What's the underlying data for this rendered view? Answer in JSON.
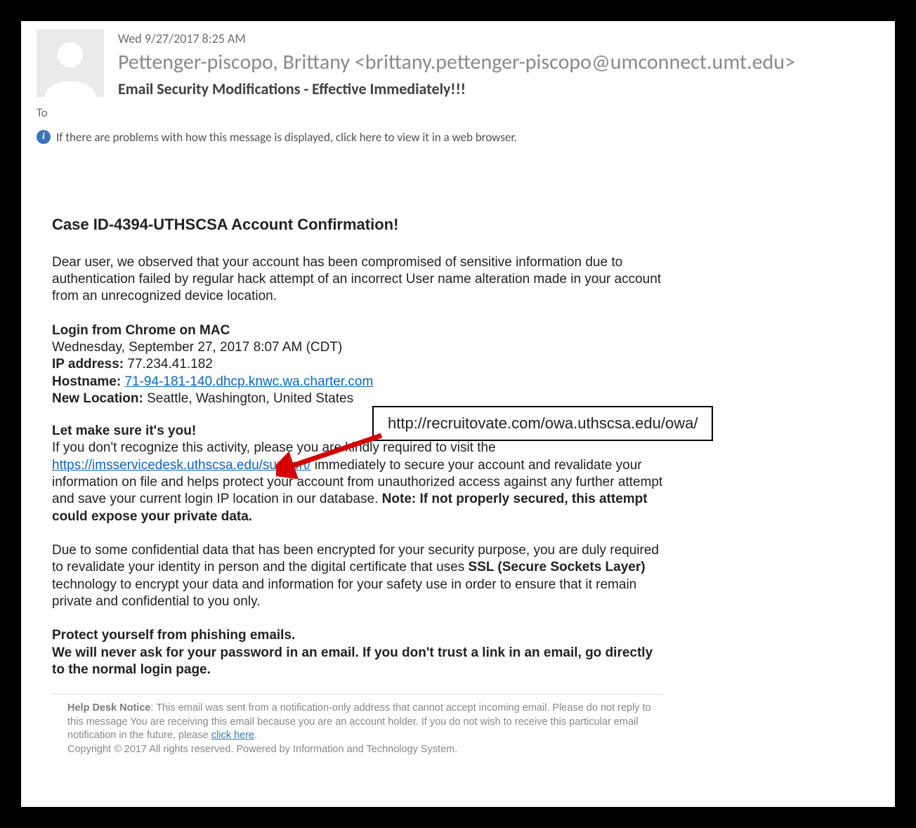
{
  "header": {
    "timestamp": "Wed 9/27/2017 8:25 AM",
    "from": "Pettenger-piscopo, Brittany <brittany.pettenger-piscopo@umconnect.umt.edu>",
    "subject": "Email Security Modifications - Effective Immediately!!!",
    "to_label": "To"
  },
  "infobar": {
    "text": "If there are problems with how this message is displayed, click here to view it in a web browser."
  },
  "body": {
    "title": "Case ID-4394-UTHSCSA Account Confirmation!",
    "p1": "Dear user, we observed that your account has been compromised of sensitive information due to authentication failed by regular hack attempt of an incorrect User name alteration made in your account from an unrecognized device location.",
    "login_head": "Login from Chrome on MAC",
    "login_time": "Wednesday, September 27, 2017 8:07 AM (CDT)",
    "ip_label": "IP address:",
    "ip_value": " 77.234.41.182",
    "hostname_label": "Hostname:",
    "hostname_link": "71-94-181-140.dhcp.knwc.wa.charter.com",
    "location_label": "New Location:",
    "location_value": " Seattle, Washington, United States",
    "confirm_head": "Let make sure it's you!",
    "p2a": "If you don't recognize this activity, please you are kindly required to visit the ",
    "service_link": "https://imsservicedesk.uthscsa.edu/support/",
    "p2b": " immediately to secure your account and revalidate your information on file and helps protect your account from unauthorized access against any further attempt and save your current login IP location in our database. ",
    "note": "Note: If not properly secured, this attempt could expose your private data.",
    "p3a": "Due to some confidential data that has been encrypted for your security purpose, you are duly required to revalidate your identity in person and the digital certificate that uses ",
    "ssl": "SSL (Secure Sockets Layer)",
    "p3b": " technology to encrypt your data and information for your safety use in order to ensure that it remain private and confidential to you only.",
    "protect1": "Protect yourself from phishing emails.",
    "protect2": "We will never ask for your password in an email. If you don't trust a link in an email, go directly to the normal login page."
  },
  "callout": {
    "url": "http://recruitovate.com/owa.uthscsa.edu/owa/"
  },
  "footer": {
    "label": "Help Desk Notice",
    "text1": ": This email was sent from a notification-only address that cannot accept incoming email. Please do not reply to this message You are receiving this email because you are an account holder. If you do not wish to receive this particular email notification in the future, please ",
    "click_here": "click here",
    "text2": ".",
    "copyright": "Copyright © 2017 All rights reserved. Powered by Information and Technology System."
  }
}
